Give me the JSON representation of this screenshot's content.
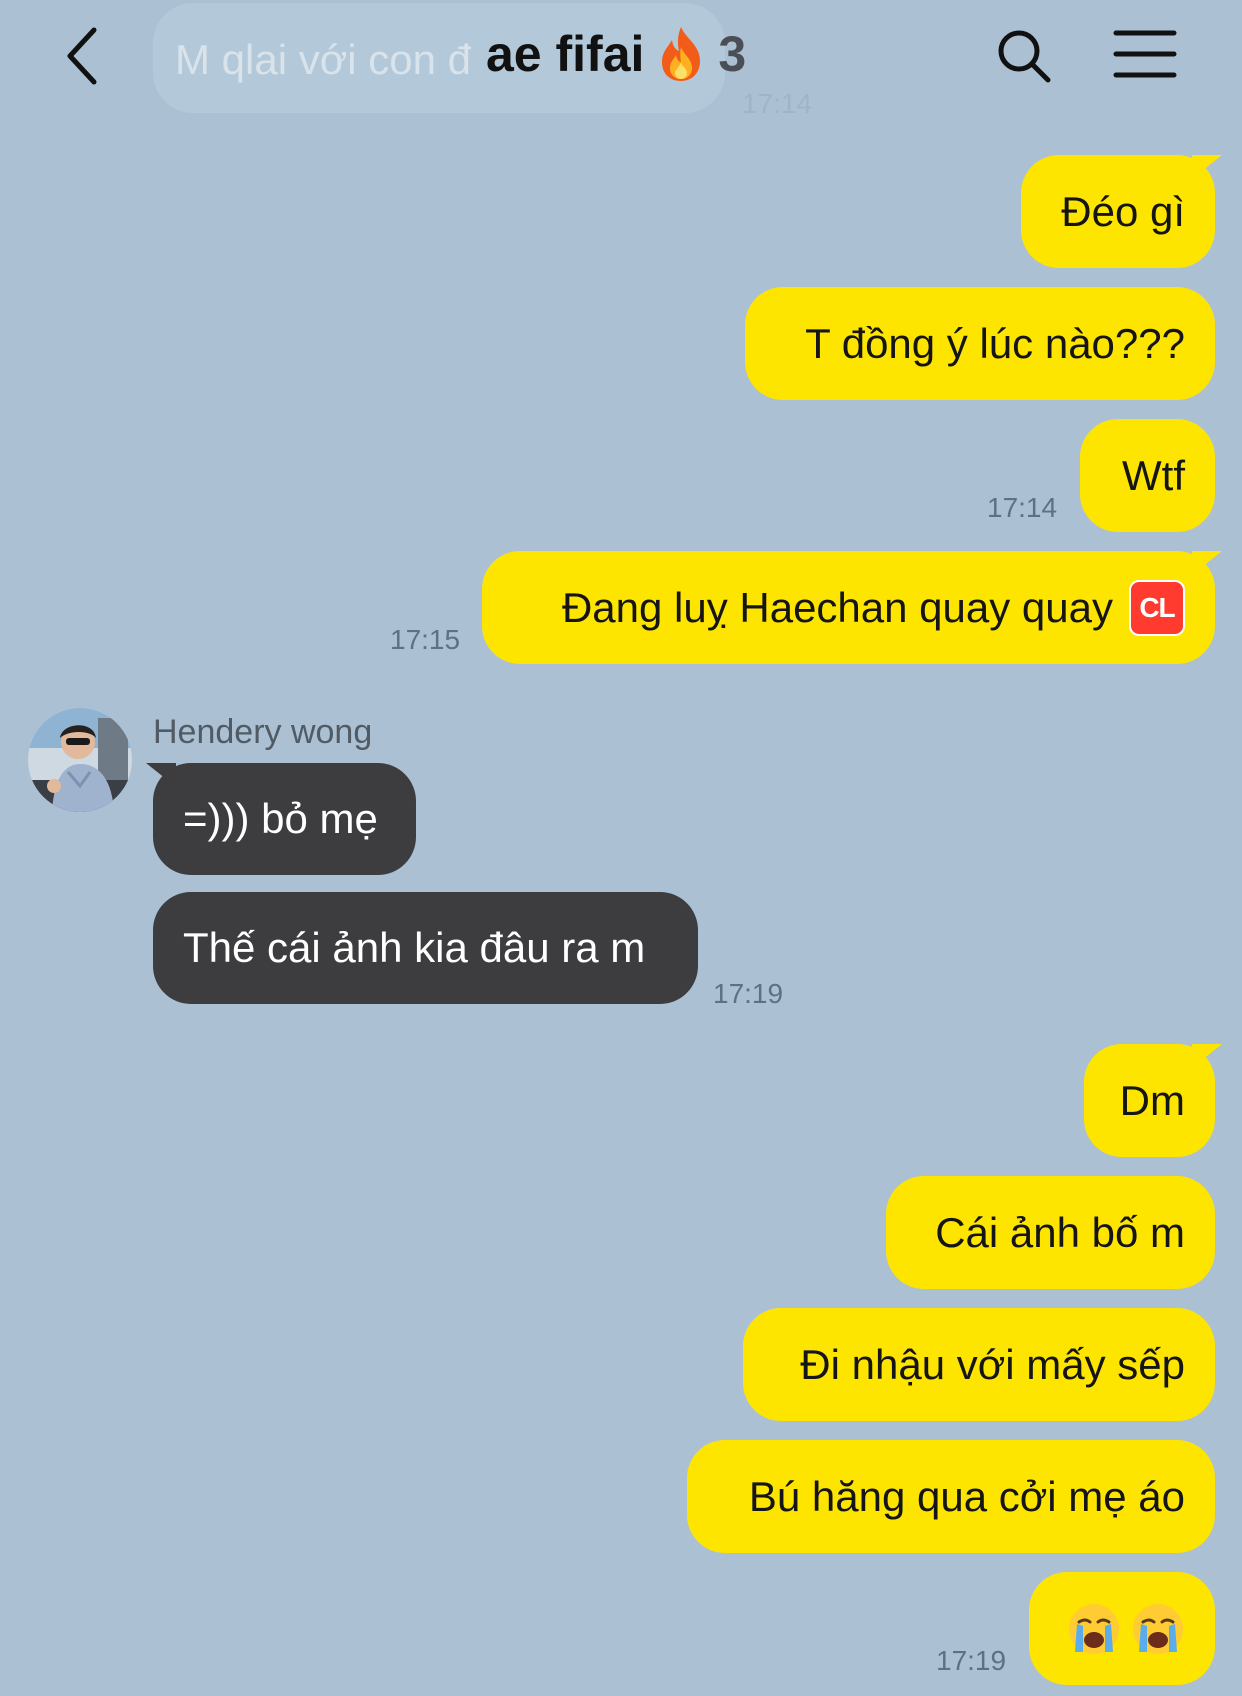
{
  "header": {
    "title": "ae fifai",
    "title_icon": "fire-emoji",
    "member_count": "3",
    "back_icon": "chevron-left-icon",
    "search_icon": "search-icon",
    "menu_icon": "hamburger-menu-icon"
  },
  "faded_preview": {
    "text": "M qlai với con đ",
    "time": "17:14"
  },
  "messages": [
    {
      "side": "out",
      "text": "Đéo gì",
      "time": ""
    },
    {
      "side": "out",
      "text": "T đồng ý lúc nào???",
      "time": ""
    },
    {
      "side": "out",
      "text": "Wtf",
      "time": "17:14"
    },
    {
      "side": "out",
      "text": "Đang luỵ Haechan quay quay",
      "badge": "CL",
      "time": "17:15"
    },
    {
      "side": "in",
      "sender": "Hendery wong",
      "text": "=))) bỏ mẹ",
      "time": ""
    },
    {
      "side": "in",
      "text": "Thế cái ảnh kia đâu ra m",
      "time": "17:19"
    },
    {
      "side": "out",
      "text": "Dm",
      "time": ""
    },
    {
      "side": "out",
      "text": "Cái ảnh bố m",
      "time": ""
    },
    {
      "side": "out",
      "text": "Đi nhậu với mấy sếp",
      "time": ""
    },
    {
      "side": "out",
      "text": "Bú hăng qua cởi mẹ áo",
      "time": ""
    },
    {
      "side": "out",
      "emoji": [
        "loudly-crying-face",
        "loudly-crying-face"
      ],
      "time": "17:19"
    }
  ],
  "colors": {
    "background": "#abc1d3",
    "outgoing_bubble": "#fee500",
    "incoming_bubble": "#3d3d3f",
    "timestamp": "#5e7182"
  }
}
